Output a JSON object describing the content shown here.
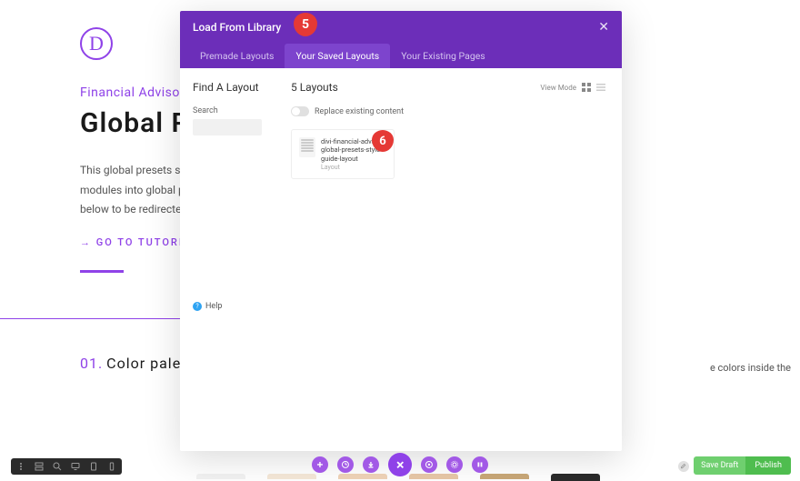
{
  "badges": {
    "five": "5",
    "six": "6"
  },
  "page": {
    "subtitle": "Financial Advisor Layo",
    "title": "Global Prese",
    "desc_l1": "This global presets style guide is a",
    "desc_l2": "modules into global presets? For a",
    "desc_l3": "below to be redirected.",
    "link": "→ GO TO TUTORIAL",
    "sec_num": "01.",
    "sec_title": "Color palette",
    "right_frag": "e colors inside the",
    "logo_letter": "D"
  },
  "modal": {
    "title": "Load From Library",
    "tabs": {
      "premade": "Premade Layouts",
      "saved": "Your Saved Layouts",
      "existing": "Your Existing Pages"
    },
    "sidebar": {
      "title": "Find A Layout",
      "search_label": "Search",
      "help": "Help"
    },
    "main": {
      "title": "5 Layouts",
      "view_label": "View Mode",
      "replace": "Replace existing content",
      "layout_name": "divi-financial-advisor-global-presets-style-guide-layout",
      "layout_type": "Layout"
    }
  },
  "bottom": {
    "save_draft": "Save Draft",
    "publish": "Publish"
  }
}
